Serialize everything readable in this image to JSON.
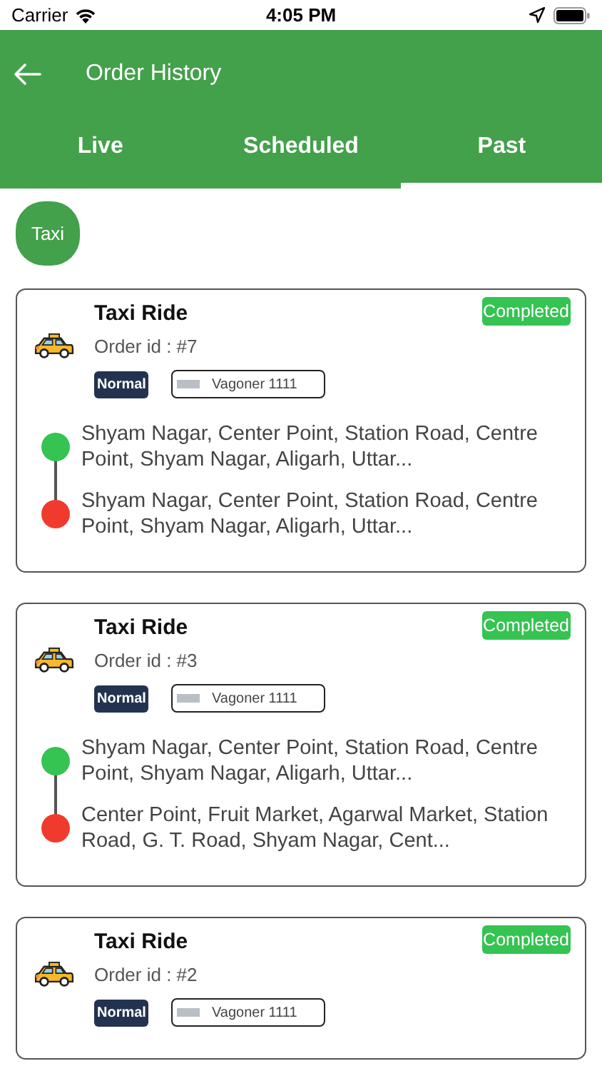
{
  "status_bar": {
    "carrier": "Carrier",
    "time": "4:05 PM"
  },
  "header": {
    "title": "Order History"
  },
  "tabs": [
    {
      "label": "Live",
      "selected": false
    },
    {
      "label": "Scheduled",
      "selected": false
    },
    {
      "label": "Past",
      "selected": true
    }
  ],
  "filters": [
    {
      "label": "Taxi",
      "selected": true
    }
  ],
  "orders": [
    {
      "title": "Taxi Ride",
      "order_id": "Order id : #7",
      "status": "Completed",
      "ride_type": "Normal",
      "vehicle": "Vagoner 1111",
      "pickup": "Shyam Nagar, Center Point, Station Road, Centre Point, Shyam Nagar, Aligarh, Uttar...",
      "dropoff": "Shyam Nagar, Center Point, Station Road, Centre Point, Shyam Nagar, Aligarh, Uttar..."
    },
    {
      "title": "Taxi Ride",
      "order_id": "Order id : #3",
      "status": "Completed",
      "ride_type": "Normal",
      "vehicle": "Vagoner 1111",
      "pickup": "Shyam Nagar, Center Point, Station Road, Centre Point, Shyam Nagar, Aligarh, Uttar...",
      "dropoff": "Center Point, Fruit Market, Agarwal Market, Station Road, G. T. Road, Shyam Nagar, Cent..."
    },
    {
      "title": "Taxi Ride",
      "order_id": "Order id : #2",
      "status": "Completed",
      "ride_type": "Normal",
      "vehicle": "Vagoner 1111"
    }
  ]
}
